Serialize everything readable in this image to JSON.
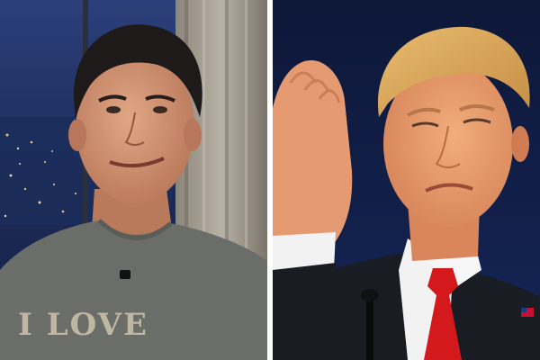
{
  "composite": {
    "left_panel": {
      "shirt_text": "I LOVE"
    },
    "right_panel": {}
  },
  "colors": {
    "left_bg_dark": "#1a2a55",
    "left_bg_city": "#2b4f8a",
    "left_shirt": "#6a6d68",
    "right_bg": "#0f1a3c",
    "suit": "#1a1c24",
    "tie": "#d3191b",
    "shirt_white": "#f2f2f2",
    "skin_left": "#c98e6e",
    "skin_right": "#e79a6a",
    "hair_left": "#1e1a1a",
    "hair_right": "#d9a45a"
  }
}
